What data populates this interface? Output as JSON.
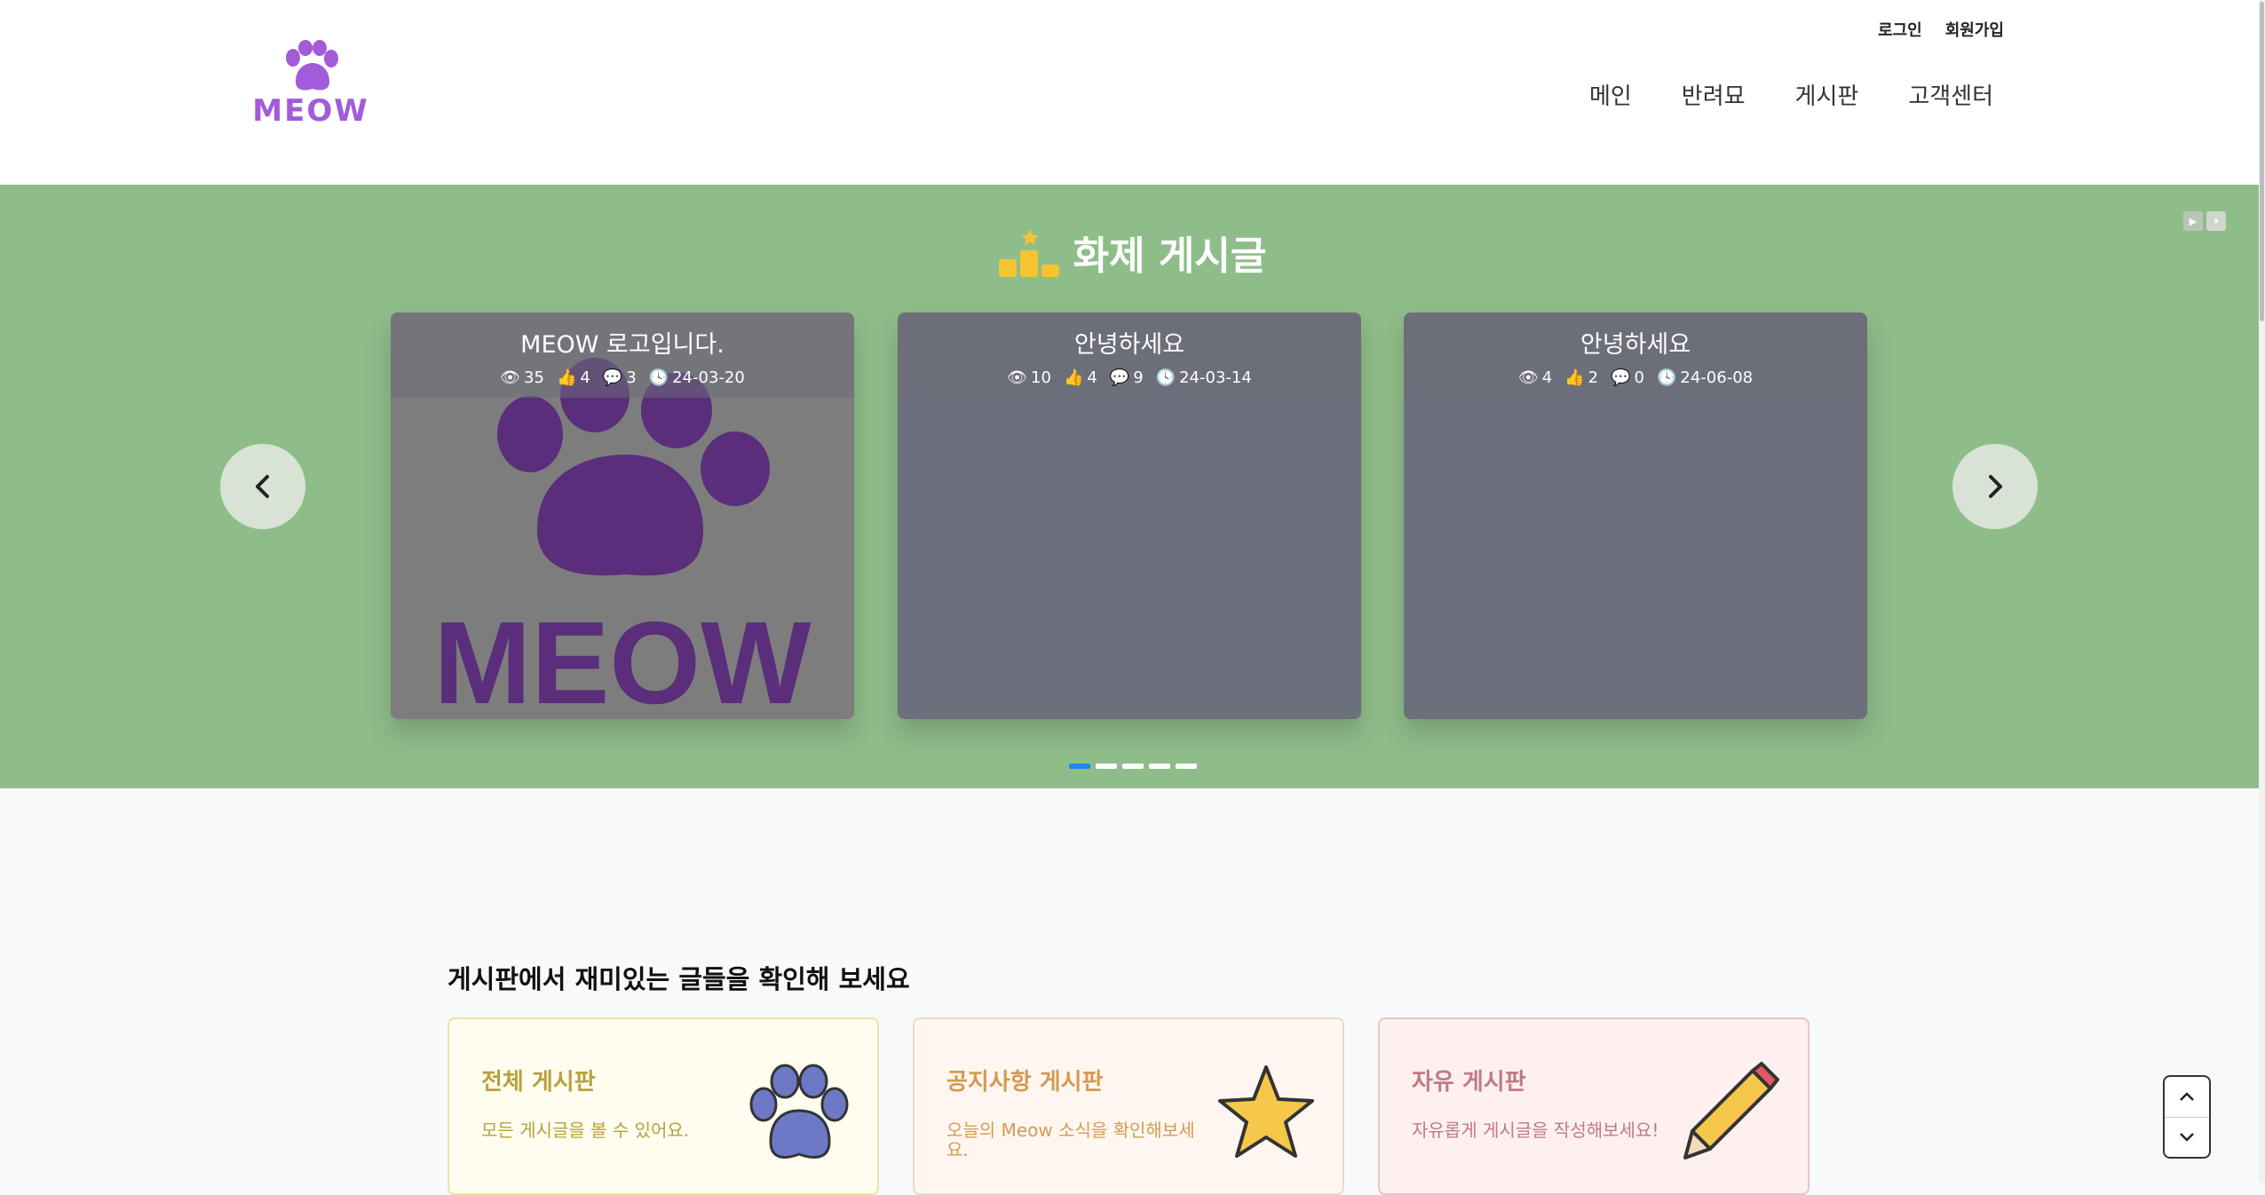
{
  "header": {
    "logo_text": "MEOW",
    "top_links": {
      "login": "로그인",
      "signup": "회원가입"
    },
    "nav": [
      "메인",
      "반려묘",
      "게시판",
      "고객센터"
    ]
  },
  "hero": {
    "title": "화제 게시글",
    "autoplay": {
      "play": "▶",
      "pause": "⏸"
    },
    "cards": [
      {
        "title": "MEOW 로고입니다.",
        "views": "35",
        "likes": "4",
        "comments": "3",
        "date": "24-03-20",
        "image_text": "MEOW"
      },
      {
        "title": "안녕하세요",
        "views": "10",
        "likes": "4",
        "comments": "9",
        "date": "24-03-14"
      },
      {
        "title": "안녕하세요",
        "views": "4",
        "likes": "2",
        "comments": "0",
        "date": "24-06-08"
      }
    ],
    "pagination_count": 5,
    "active_page": 1
  },
  "boards_section": {
    "title": "게시판에서 재미있는 글들을 확인해 보세요",
    "boards": [
      {
        "title": "전체 게시판",
        "desc": "모든 게시글을 볼 수 있어요.",
        "icon": "paw-icon"
      },
      {
        "title": "공지사항 게시판",
        "desc": "오늘의 Meow 소식을 확인해보세요.",
        "icon": "star-icon"
      },
      {
        "title": "자유 게시판",
        "desc": "자유롭게 게시글을 작성해보세요!",
        "icon": "pencil-icon"
      }
    ]
  },
  "colors": {
    "brand_purple": "#a25bd9",
    "hero_green": "#8fbd8a",
    "active_dot": "#1e88e5"
  }
}
